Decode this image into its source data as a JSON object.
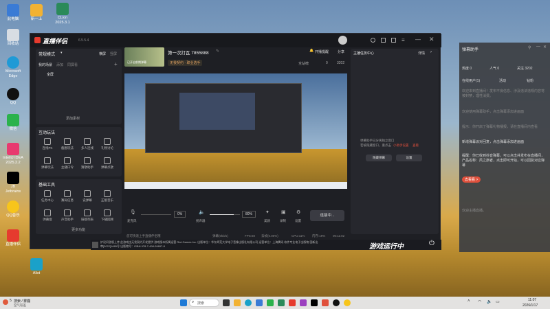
{
  "desktop": {
    "icons": [
      {
        "label": "此电脑",
        "color": "#3a7bd5"
      },
      {
        "label": "回收站",
        "color": "#d8dde3"
      },
      {
        "label": "Microsoft Edge",
        "color": "#1f9ad6"
      },
      {
        "label": "QQ",
        "color": "#111111"
      },
      {
        "label": "微信",
        "color": "#2bb24c"
      },
      {
        "label": "IntelliJ IDEA 2025.2.2",
        "color": "#e83a6f"
      },
      {
        "label": "JB Jetbrains",
        "color": "#000000"
      },
      {
        "label": "QQ音乐",
        "color": "#f7c51b"
      },
      {
        "label": "直播伴侣",
        "color": "#e63b2e"
      },
      {
        "label": "Alist",
        "color": "#1aa1c9"
      }
    ],
    "top_icons": [
      {
        "label": "新一上",
        "color": "#f2b233"
      },
      {
        "label": "CLion 2025.3.1",
        "color": "#2a8a5a"
      }
    ]
  },
  "app": {
    "title": "直播伴侣",
    "version": "6.5.5.4",
    "mode_label": "常规模式",
    "sidebar_tabs": [
      "横屏",
      "竖屏"
    ],
    "scene_label": "我的场景",
    "scene_tabs": [
      "添加",
      "同屏看"
    ],
    "scene_item": "全屏",
    "add_material": "添加素材",
    "section_interact": "互动玩法",
    "interact_tools": [
      "连线PK",
      "截图玩法",
      "多人连线",
      "礼物讨论",
      "弹幕玩法",
      "主播口令",
      "猜歌助手",
      "弹幕点歌"
    ],
    "section_basic": "基础工具",
    "basic_tools": [
      "任务中心",
      "赛局信息",
      "说弹幕",
      "正版音乐",
      "弹幕窗",
      "声音助手",
      "链接列表",
      "下播回顾"
    ],
    "more": "更多功能",
    "stream_title": "第一次打瓦 7855888",
    "game_tag": "无畏契约 · 职业选手",
    "game_thumb_label": "已开启前期弹幕",
    "top_actions": [
      "开播提醒",
      "分享"
    ],
    "stats": [
      "全站榜",
      "0",
      "3202"
    ],
    "mic_label": "麦克风",
    "mic_level": "0%",
    "speaker_label": "扬声器",
    "speaker_level": "80%",
    "speaker_volume_pct": 80,
    "ctrl_icons": [
      "美颜",
      "录制",
      "设置"
    ],
    "connect_button": "连接中...",
    "right_title": "主播任务中心",
    "right_detail": "详情",
    "right_text_1": "弹幕助手已分离独立窗口",
    "right_text_2": "若被隐藏窗口，重点击",
    "right_link_1": "小助手设置",
    "right_link_2": "查看",
    "right_btn_1": "隐藏弹幕",
    "right_btn_2": "设置",
    "status": [
      "您可快速上手直播伴侣哦",
      "弹幕(0kb/s)",
      "FPS:60",
      "丢帧(0.00%)",
      "CPU:11%",
      "内存:19%",
      "00:11:02"
    ],
    "ticker_text": "护设问答版上传 此游戏由无畏契约开发提供 游戏版本所属运营 Riot Games Inc. 出版单位：华东师范大学电子音像出版社有限公司 运营单位：上海腾讯 软件专业电子出版物 国新出审[2022]1665号 出版物号：ISBN 978-7-498-09897-8",
    "ticker_banner": "游戏运行中"
  },
  "assistant": {
    "title": "弹幕助手",
    "stats": [
      "热度 0",
      "人气 0",
      "关注 3202"
    ],
    "tabs": [
      "在线用户(1)",
      "活动",
      "钻粉"
    ],
    "msgs": [
      "欢迎来到直播间！发布不良信息、涉及违法违规内容将被封禁，理性消费。",
      "欢迎使用弹幕助手，点击弹幕添加进画面",
      "提示：你开启了弹幕礼物播报，请在直播间内查看",
      "新增弹幕派对回复，点击弹幕添加进画面",
      "提醒：你已收到抖音弹幕，可以点击并发布在直播间，产品名称：风之旅者，点击即可开始，可以回复对应弹幕",
      "去看看 >",
      "欢迎主播直播。"
    ]
  },
  "taskbar": {
    "weather_temp": "5",
    "weather_text": "搜索 / 雾霾",
    "weather_sub": "空气较差",
    "search_placeholder": "搜索",
    "time": "11:07",
    "date": "2026/1/17"
  }
}
